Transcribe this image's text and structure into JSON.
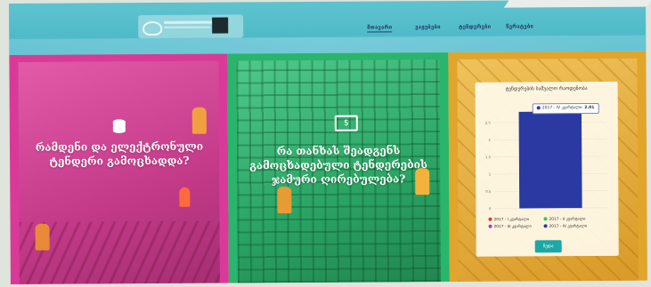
{
  "header": {
    "logo": "logo",
    "nav": [
      "მთავარი",
      "ვაჟებები",
      "ტენდერები",
      "წერატები"
    ]
  },
  "panels": [
    {
      "icon": "database-icon",
      "question": "რამდენი და ელექტრონული ტენდერი გამოცხადდა?"
    },
    {
      "icon": "money-icon",
      "question": "რა თანხას შეადგენს გამოცხადებული ტენდერების ჯამური ღირებულება?"
    }
  ],
  "chart_data": {
    "type": "bar",
    "title": "ტენდერების საშუალო რაოდენობა",
    "ylabel": "",
    "categories": [
      "2017 - IV კვარტალი"
    ],
    "series": [
      {
        "name": "2017 - I კვარტალი",
        "color": "#d43b3b",
        "values": [
          null
        ]
      },
      {
        "name": "2017 - II კვარტალი",
        "color": "#3fbf5a",
        "values": [
          null
        ]
      },
      {
        "name": "2017 - III კვარტალი",
        "color": "#9b40c7",
        "values": [
          null
        ]
      },
      {
        "name": "2017 - IV კვარტალი",
        "color": "#2a3aa2",
        "values": [
          2.81
        ]
      }
    ],
    "ylim": [
      0,
      3
    ],
    "yticks": [
      "2.5",
      "2",
      "1.5",
      "1",
      "0.5",
      "0"
    ],
    "tooltip": {
      "label": "2017 - IV კვარტალი",
      "value": "2.81"
    },
    "button": "ზედა"
  },
  "colors": {
    "panel1": "#d93a98",
    "panel2": "#29b56c",
    "panel3": "#e0a52a",
    "header": "#4fb9c7",
    "bar": "#2a3aa2",
    "button": "#1ba8a6"
  }
}
